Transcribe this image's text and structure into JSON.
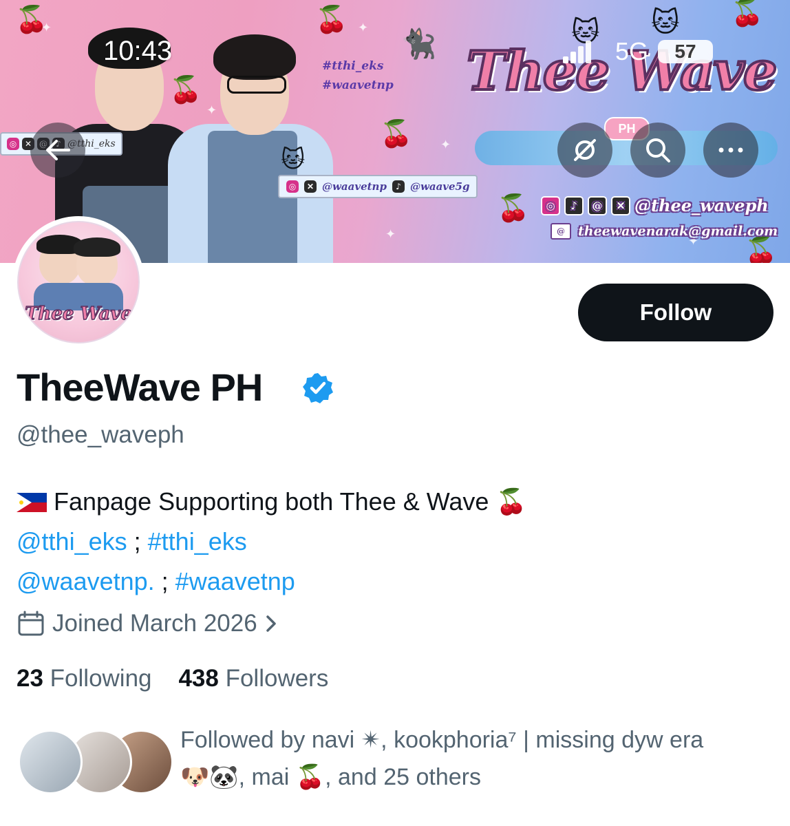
{
  "status_bar": {
    "time": "10:43",
    "network": "5G",
    "battery": "57"
  },
  "banner": {
    "tags": [
      "#tthi_eks",
      "#waavetnp"
    ],
    "logo_title": "Thee Wave",
    "logo_sub": "PH",
    "socials_left": "@tthi_eks",
    "socials_mid_1": "@waavetnp",
    "socials_mid_2": "@waave5g",
    "right_handle": "@thee_waveph",
    "right_email": "theewavenarak@gmail.com"
  },
  "avatar": {
    "title": "Thee Wave"
  },
  "actions": {
    "follow_label": "Follow"
  },
  "profile": {
    "display_name": "TheeWave PH",
    "handle": "@thee_waveph",
    "bio_line1_text": "Fanpage Supporting both Thee & Wave",
    "bio_line1_emoji": "🍒",
    "bio_line2_mention": "@tthi_eks",
    "bio_line2_sep": " ; ",
    "bio_line2_hashtag": "#tthi_eks",
    "bio_line3_mention": "@waavetnp.",
    "bio_line3_sep": " ; ",
    "bio_line3_hashtag": "#waavetnp",
    "joined": "Joined March 2026"
  },
  "stats": {
    "following_count": "23",
    "following_label": "Following",
    "followers_count": "438",
    "followers_label": "Followers"
  },
  "followed_by": {
    "line1": "Followed by navi ✴, kookphoria⁷ | missing dyw era",
    "line2": "🐶🐼, mai 🍒, and 25 others"
  },
  "colors": {
    "link": "#1d9bf0",
    "text": "#0f1419",
    "secondary": "#536471",
    "verified": "#1d9bf0",
    "button_bg": "#0f1419"
  }
}
